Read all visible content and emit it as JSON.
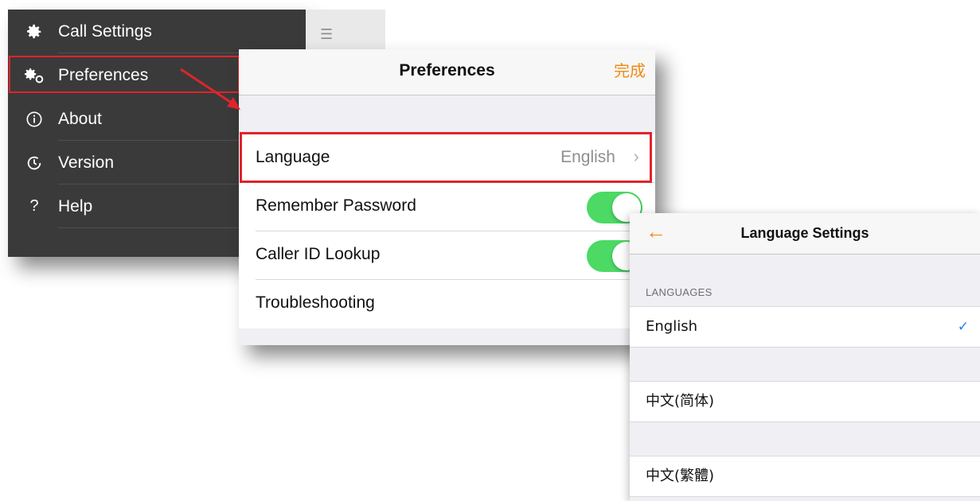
{
  "menu": {
    "items": [
      {
        "icon": "gear-icon",
        "label": "Call Settings"
      },
      {
        "icon": "gears-icon",
        "label": "Preferences"
      },
      {
        "icon": "info-icon",
        "label": "About"
      },
      {
        "icon": "clock-icon",
        "label": "Version"
      },
      {
        "icon": "question-icon",
        "label": "Help"
      }
    ]
  },
  "preferences": {
    "title": "Preferences",
    "done_label": "完成",
    "rows": [
      {
        "label": "Language",
        "value": "English"
      },
      {
        "label": "Remember Password",
        "toggle": true
      },
      {
        "label": "Caller ID Lookup",
        "toggle": true
      },
      {
        "label": "Troubleshooting"
      }
    ]
  },
  "language_settings": {
    "title": "Language Settings",
    "section_label": "LANGUAGES",
    "languages": [
      {
        "label": "English",
        "selected": true
      },
      {
        "label": "中文(简体)",
        "selected": false
      },
      {
        "label": "中文(繁體)",
        "selected": false
      }
    ]
  },
  "colors": {
    "accent_orange": "#f08c14",
    "toggle_on": "#4cd964",
    "highlight_red": "#e0242b",
    "check_blue": "#1e7cf2",
    "menu_bg": "#3a3a3a"
  }
}
